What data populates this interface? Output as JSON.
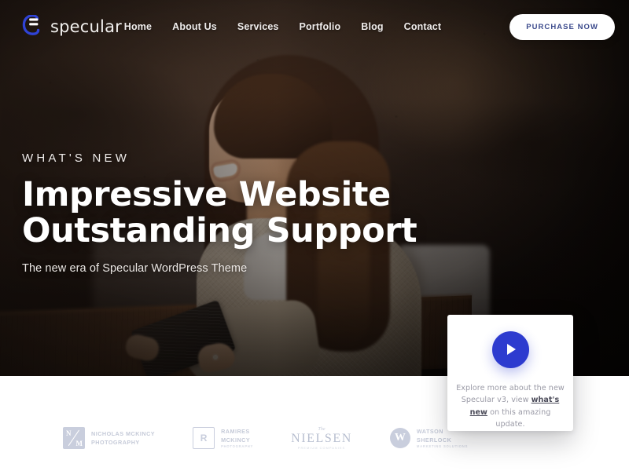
{
  "brand": {
    "name": "specular",
    "logo_icon": "specular-s-logo-icon",
    "logo_color": "#2f43d6"
  },
  "nav": {
    "items": [
      {
        "label": "Home"
      },
      {
        "label": "About Us"
      },
      {
        "label": "Services"
      },
      {
        "label": "Portfolio"
      },
      {
        "label": "Blog"
      },
      {
        "label": "Contact"
      }
    ],
    "cta_label": "PURCHASE NOW",
    "cta_text_color": "#3b4a8c",
    "cta_bg_color": "#ffffff"
  },
  "hero": {
    "eyebrow": "WHAT'S NEW",
    "headline_line1": "Impressive Website",
    "headline_line2": "Outstanding Support",
    "subhead": "The new era of Specular WordPress Theme",
    "background_description": "Smiling woman with long brown hair in a cream knit sweater holding a tablet at a dark wooden table"
  },
  "video_card": {
    "play_icon": "play-icon",
    "play_button_color": "#2d3bcf",
    "text_before": "Explore more about the new Specular v3, view ",
    "link_label": "what's new",
    "text_after": " on this amazing update."
  },
  "clients": [
    {
      "mark": "nm-monogram-icon",
      "mark_letters_top": "N",
      "mark_letters_bottom": "M",
      "name_line1": "NICHOLAS MCKINCY",
      "name_line2": "PHOTOGRAPHY",
      "sub": ""
    },
    {
      "mark": "r-monogram-icon",
      "mark_letter": "R",
      "name_line1": "RAMIRES",
      "name_line2": "MCKINCY",
      "sub": "PHOTOGRAPHY"
    },
    {
      "mark": "nielsen-wordmark-icon",
      "serif_the": "The",
      "serif_name": "NIELSEN",
      "sub": "PREMIUM COMPANIES"
    },
    {
      "mark": "w-circle-icon",
      "mark_letter": "W",
      "name_line1": "WATSON",
      "name_line2": "SHERLOCK",
      "sub": "MARKETING SOLUTIONS"
    }
  ]
}
